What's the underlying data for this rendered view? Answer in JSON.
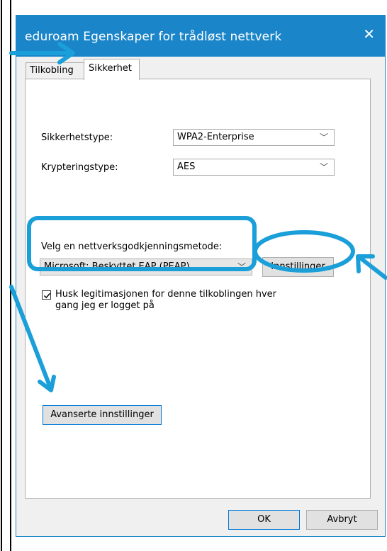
{
  "window": {
    "title": "eduroam Egenskaper for trådløst nettverk",
    "close_icon": "close-icon"
  },
  "tabs": [
    {
      "label": "Tilkobling",
      "active": false
    },
    {
      "label": "Sikkerhet",
      "active": true
    }
  ],
  "security": {
    "type_label": "Sikkerhetstype:",
    "type_value": "WPA2-Enterprise",
    "encryption_label": "Krypteringstype:",
    "encryption_value": "AES"
  },
  "auth": {
    "method_label": "Velg en nettverksgodkjenningsmetode:",
    "method_value": "Microsoft: Beskyttet EAP (PEAP)",
    "settings_button": "Innstillinger",
    "remember_checked": true,
    "remember_label": "Husk legitimasjonen for denne tilkoblingen hver gang jeg er logget på"
  },
  "advanced_button": "Avanserte innstillinger",
  "footer": {
    "ok": "OK",
    "cancel": "Avbryt"
  },
  "annotation_color": "#1a9fd9"
}
